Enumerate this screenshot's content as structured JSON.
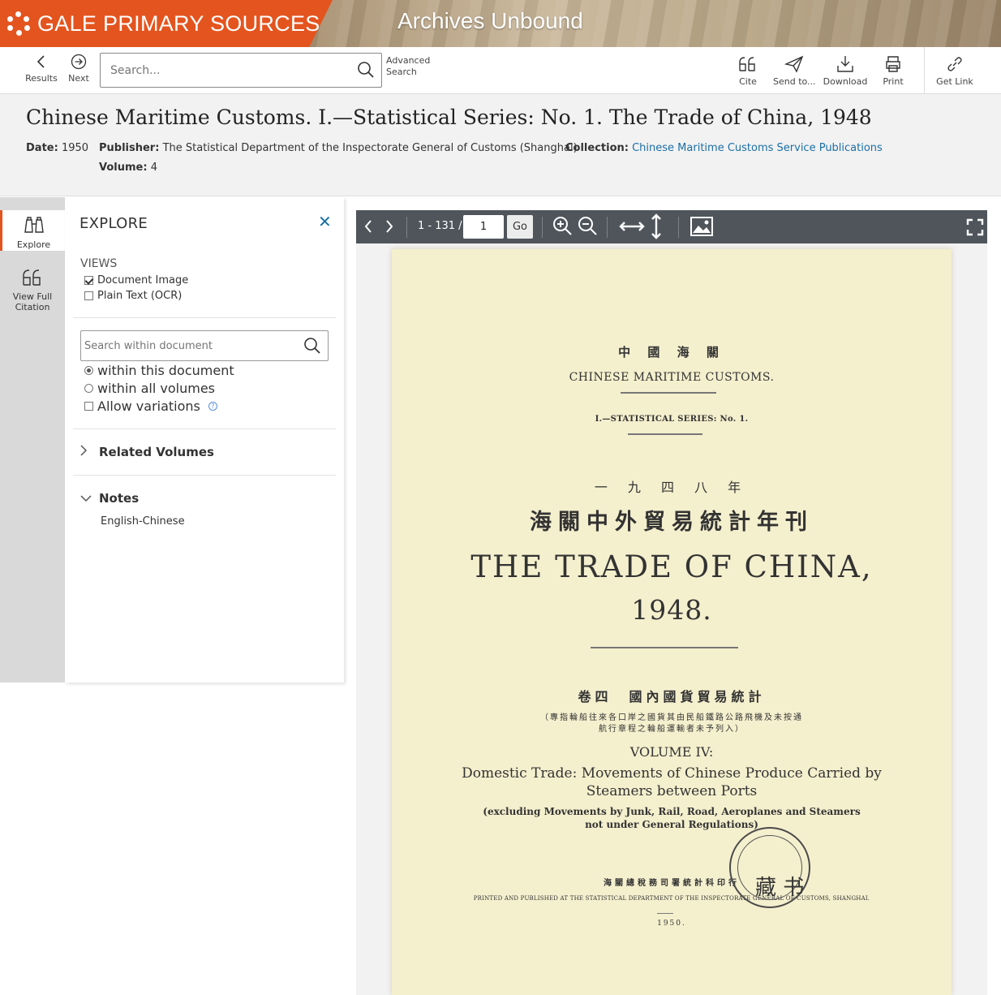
{
  "banner": {
    "brand": "GALE PRIMARY SOURCES",
    "product": "Archives Unbound",
    "brand_color": "#e4541f"
  },
  "toolbar": {
    "results_label": "Results",
    "next_label": "Next",
    "search_placeholder": "Search...",
    "advanced_line1": "Advanced",
    "advanced_line2": "Search",
    "cite_label": "Cite",
    "send_label": "Send to...",
    "download_label": "Download",
    "print_label": "Print",
    "getlink_label": "Get Link"
  },
  "citation": {
    "title": "Chinese Maritime Customs. I.—Statistical Series: No. 1. The Trade of China, 1948",
    "date_label": "Date:",
    "date_value": "1950",
    "publisher_label": "Publisher:",
    "publisher_value": "The Statistical Department of the Inspectorate General of Customs (Shanghai)",
    "collection_label": "Collection:",
    "collection_value": "Chinese Maritime Customs Service Publications",
    "volume_label": "Volume:",
    "volume_value": "4",
    "link_color": "#1a6fa6"
  },
  "rail": {
    "explore_label": "Explore",
    "citation_label_1": "View Full",
    "citation_label_2": "Citation"
  },
  "explore": {
    "title": "EXPLORE",
    "close": "✕",
    "views_title": "VIEWS",
    "view_document_image": "Document Image",
    "view_plain_text": "Plain Text (OCR)",
    "search_placeholder": "Search within document",
    "opt_this_document": "within this document",
    "opt_all_volumes": "within all volumes",
    "opt_allow_variations": "Allow variations",
    "related_volumes": "Related Volumes",
    "notes": "Notes",
    "notes_value": "English-Chinese"
  },
  "viewer": {
    "page_range": "1 - 131 /",
    "page_value": "1",
    "go_label": "Go",
    "toolbar_color": "#4f555b"
  },
  "document": {
    "cn_header": "中 國 海 關",
    "en_header": "CHINESE  MARITIME  CUSTOMS.",
    "series": "I.—STATISTICAL  SERIES:  No.  1.",
    "cn_year": "一 九 四 八 年",
    "cn_title": "海關中外貿易統計年刊",
    "en_title": "THE  TRADE  OF  CHINA,",
    "year": "1948.",
    "cn_volume": "卷四　國內國貨貿易統計",
    "cn_note_1": "（專指輪船往來各口岸之國貨其由民船鐵路公路飛機及未按通",
    "cn_note_2": "航行章程之輪船運輸者未予列入）",
    "volume": "VOLUME  IV:",
    "subtitle_1": "Domestic  Trade:  Movements  of  Chinese  Produce  Carried  by",
    "subtitle_2": "Steamers  between  Ports",
    "excluding_1": "(excluding Movements by Junk, Rail, Road, Aeroplanes and Steamers",
    "excluding_2": "not under General Regulations)",
    "cn_printer": "海關總稅務司署統計科印行",
    "printed": "PRINTED AND PUBLISHED AT THE STATISTICAL DEPARTMENT OF THE INSPECTORATE GENERAL OF CUSTOMS, SHANGHAI.",
    "pub_year": "1950.",
    "seal_text": "藏 书",
    "paper_color": "#f4efcd"
  }
}
